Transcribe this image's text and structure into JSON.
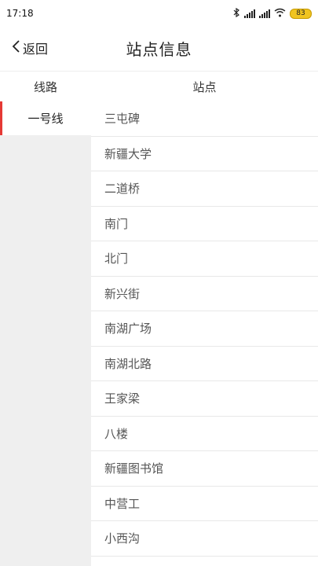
{
  "status": {
    "time": "17:18",
    "battery": "83"
  },
  "header": {
    "back_label": "返回",
    "title": "站点信息"
  },
  "columns": {
    "line": "线路",
    "station": "站点"
  },
  "lines": [
    {
      "label": "一号线",
      "selected": true
    }
  ],
  "stations": [
    "三屯碑",
    "新疆大学",
    "二道桥",
    "南门",
    "北门",
    "新兴街",
    "南湖广场",
    "南湖北路",
    "王家梁",
    "八楼",
    "新疆图书馆",
    "中营工",
    "小西沟"
  ],
  "colors": {
    "accent": "#e53935",
    "left_bg": "#efefef",
    "battery": "#f0c420"
  }
}
